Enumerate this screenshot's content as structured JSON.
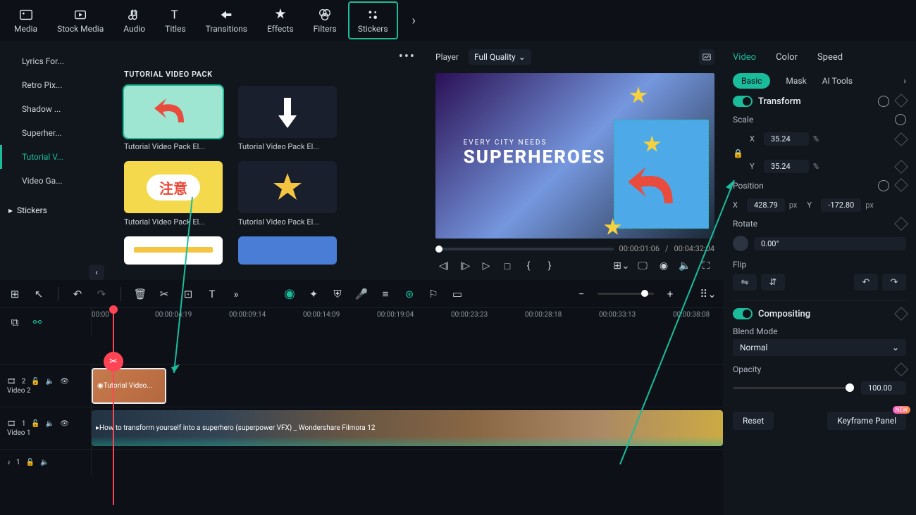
{
  "topnav": {
    "items": [
      "Media",
      "Stock Media",
      "Audio",
      "Titles",
      "Transitions",
      "Effects",
      "Filters",
      "Stickers"
    ],
    "active": "Stickers"
  },
  "sidebar": {
    "items": [
      "Lyrics For...",
      "Retro Pix...",
      "Shadow ...",
      "Superher...",
      "Tutorial V...",
      "Video Ga..."
    ],
    "active": "Tutorial V...",
    "category": "Stickers"
  },
  "assets": {
    "pack_title": "TUTORIAL VIDEO PACK",
    "items": [
      "Tutorial Video Pack El...",
      "Tutorial Video Pack El...",
      "Tutorial Video Pack El...",
      "Tutorial Video Pack El..."
    ]
  },
  "player": {
    "label": "Player",
    "quality": "Full Quality",
    "cur": "00:00:01:06",
    "total": "00:04:32:04",
    "overlay_sub": "EVERY CITY NEEDS",
    "overlay_main": "SUPERHEROES"
  },
  "inspector": {
    "tabs": [
      "Video",
      "Color",
      "Speed"
    ],
    "active_tab": "Video",
    "subtabs": {
      "basic": "Basic",
      "mask": "Mask",
      "ai": "AI Tools"
    },
    "transform": {
      "title": "Transform",
      "scale": "Scale",
      "scale_x": "35.24",
      "scale_y": "35.24",
      "pos": "Position",
      "pos_x": "428.79",
      "pos_y": "-172.80",
      "rotate": "Rotate",
      "rotate_val": "0.00°",
      "flip": "Flip",
      "pct": "%",
      "px": "px"
    },
    "compositing": {
      "title": "Compositing",
      "blend_label": "Blend Mode",
      "blend": "Normal",
      "opacity_label": "Opacity",
      "opacity": "100.00"
    },
    "buttons": {
      "reset": "Reset",
      "keyframe": "Keyframe Panel",
      "new": "NEW"
    }
  },
  "timeline": {
    "ticks": [
      "00:00",
      "00:00:04:19",
      "00:00:09:14",
      "00:00:14:09",
      "00:00:19:04",
      "00:00:23:23",
      "00:00:28:18",
      "00:00:33:13",
      "00:00:38:08"
    ],
    "track2_label": "Video 2",
    "track1_label": "Video 1",
    "clip_sticker": "Tutorial Video...",
    "clip_video": "How to transform yourself into a superhero (superpower VFX) _ Wondershare Filmora 12",
    "track2_badge": "2",
    "track1_badge": "1",
    "audio_badge": "1"
  }
}
